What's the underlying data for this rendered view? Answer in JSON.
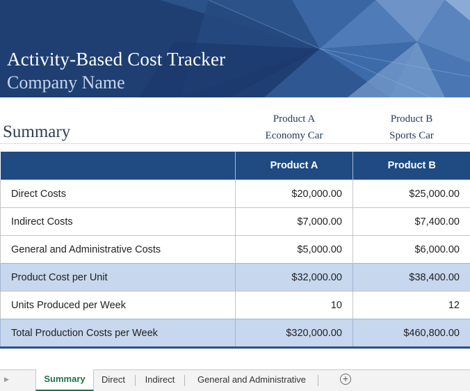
{
  "header": {
    "title": "Activity-Based Cost Tracker",
    "company": "Company Name"
  },
  "summary": {
    "heading": "Summary",
    "products": [
      {
        "name": "Product A",
        "type": "Economy Car"
      },
      {
        "name": "Product B",
        "type": "Sports Car"
      }
    ]
  },
  "table": {
    "columns": [
      "",
      "Product A",
      "Product B"
    ],
    "rows": [
      {
        "label": "Direct Costs",
        "a": "$20,000.00",
        "b": "$25,000.00",
        "highlight": false
      },
      {
        "label": "Indirect Costs",
        "a": "$7,000.00",
        "b": "$7,400.00",
        "highlight": false
      },
      {
        "label": "General and Administrative Costs",
        "a": "$5,000.00",
        "b": "$6,000.00",
        "highlight": false
      },
      {
        "label": "Product Cost per Unit",
        "a": "$32,000.00",
        "b": "$38,400.00",
        "highlight": true
      },
      {
        "label": "Units Produced per Week",
        "a": "10",
        "b": "12",
        "highlight": false
      },
      {
        "label": "Total Production Costs per Week",
        "a": "$320,000.00",
        "b": "$460,800.00",
        "highlight": true
      }
    ]
  },
  "sheet_tabs": {
    "tabs": [
      "Summary",
      "Direct",
      "Indirect",
      "General and Administrative"
    ],
    "active": "Summary",
    "add_icon": "plus-circle-icon",
    "scroll_icon": "scroll-left-icon"
  },
  "colors": {
    "banner": "#1f3f73",
    "table_header": "#1f4a82",
    "highlight_row": "#c6d7ee",
    "active_tab": "#217346"
  }
}
